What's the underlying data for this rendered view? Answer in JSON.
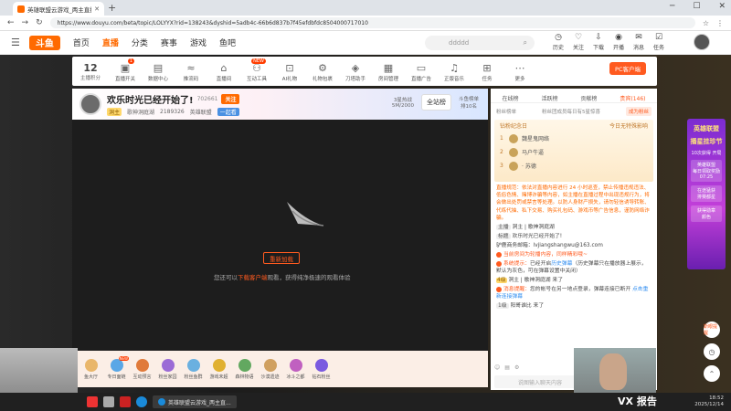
{
  "browser": {
    "tab_title": "英雄联盟云游戏_两主直播_两主 | 斗鱼",
    "url": "https://www.douyu.com/beta/topic/LOLYYX?rid=138243&dyshid=5adb4c-66b6d837b7f45efdbfdc8504000717010"
  },
  "site": {
    "logo": "斗鱼",
    "nav": [
      "首页",
      "直播",
      "分类",
      "赛事",
      "游戏",
      "鱼吧"
    ],
    "search_placeholder": "ddddd",
    "header_icons": [
      {
        "icon": "history-icon",
        "label": "历史"
      },
      {
        "icon": "follow-icon",
        "label": "关注"
      },
      {
        "icon": "download-icon",
        "label": "下载"
      },
      {
        "icon": "broadcast-icon",
        "label": "开播"
      },
      {
        "icon": "message-icon",
        "label": "消息"
      },
      {
        "icon": "task-icon",
        "label": "任务"
      }
    ]
  },
  "toolbar": {
    "level_number": "12",
    "level_label": "主播积分",
    "tools": [
      {
        "label": "直播开关",
        "icon": "switch-icon",
        "badge": "1"
      },
      {
        "label": "数据中心",
        "icon": "data-icon"
      },
      {
        "label": "推流码",
        "icon": "wave-icon"
      },
      {
        "label": "直播间",
        "icon": "room-icon"
      },
      {
        "label": "互动工具",
        "icon": "people-icon",
        "badge": "NEW"
      },
      {
        "label": "AI礼物",
        "icon": "ai-icon"
      },
      {
        "label": "礼物包裹",
        "icon": "gift-box-icon"
      },
      {
        "label": "刀塔助手",
        "icon": "helper-icon"
      },
      {
        "label": "房间管理",
        "icon": "manage-icon"
      },
      {
        "label": "直播广告",
        "icon": "ad-icon"
      },
      {
        "label": "正版音乐",
        "icon": "music-icon"
      },
      {
        "label": "任务",
        "icon": "gift-icon"
      },
      {
        "label": "更多",
        "icon": "more-icon"
      }
    ],
    "pc_button": "PC客户端"
  },
  "room": {
    "title": "欢乐时光已经开始了!",
    "room_id": "702661",
    "follow_label": "关注",
    "host_label": "洞主",
    "category": "歌神洞庭湖",
    "fans_count": "2189326",
    "game": "英雄联盟",
    "link_label": "一起看",
    "hot_label": "3星热战",
    "hot_value": "5M/2000",
    "all_station_label": "全站榜",
    "rank_label": "斗鱼榜单",
    "rank_value": "排10名"
  },
  "video": {
    "reload_label": "重新加载",
    "tip_before": "您还可以",
    "tip_highlight": "下载客户端",
    "tip_after": "观看，获得纯净极速的观看体验"
  },
  "gifts": [
    {
      "label": "鱼大厅"
    },
    {
      "label": "专日面链",
      "badge": "NEW"
    },
    {
      "label": "互动预言"
    },
    {
      "label": "粉丝家园"
    },
    {
      "label": "粉丝鱼群"
    },
    {
      "label": "游戏未超"
    },
    {
      "label": "森林物语"
    },
    {
      "label": "沙漠遗迹"
    },
    {
      "label": "冰斗之都"
    },
    {
      "label": "钻石粉丝"
    }
  ],
  "chat": {
    "rank_tabs": [
      "在线榜",
      "活跃榜",
      "贡献榜",
      "贵宾(146)"
    ],
    "fans_text": "粉丝榜单",
    "fans_sub": "粉丝团成员每日有5星惊喜",
    "fans_btn": "成为粉丝",
    "vip_title": "钻粉纪念日",
    "vip_right": "今日无特殊影响",
    "vip_list": [
      {
        "rank": "1",
        "name": "魏星鬼网络"
      },
      {
        "rank": "2",
        "name": "马户牛逼"
      },
      {
        "rank": "3",
        "name": "· 苏德"
      }
    ],
    "notice": "直播规范：依法对直播内容进行 24 小时巡查，禁止传播违规违法、低俗色情、赌博诈骗等内容，如主播在直播过程中出现违规行为，将会做出处罚或禁言等处理。以防人身财产损失，请勿轻信诱导转账、代练代抽、私下交易、购买礼包码、游戏币等广告信息，谨防网络诈骗。",
    "messages": [
      {
        "key": "主播",
        "text": "洞主 | 歌神洞庭湖"
      },
      {
        "key": "标题",
        "text": "欢乐时光已经开始了!"
      },
      {
        "key": "",
        "text": "驴鹿商务邮箱：lvjiangshangwu@163.com"
      },
      {
        "key": "",
        "sys": "当前房间为轮播内容，同样精彩哦~"
      },
      {
        "key": "",
        "sys": "系统提示：",
        "text": "已经开启",
        "blue": "历史弹幕",
        "tail": "（历史弹幕只在播放器上展示，默认为灰色，可在弹幕设置中关闭）"
      },
      {
        "key": "",
        "lvl": "4级",
        "text": "洞主 | 歌神洞庭湖 来了"
      },
      {
        "key": "",
        "sys": "消息提醒：",
        "text": "您的帐号在另一地点登录，弹幕连接已断开",
        "blue": "点击重新连接弹幕"
      },
      {
        "key": "1级",
        "text": "阳哥谁比 来了"
      }
    ],
    "input_placeholder": "说图输入聊天内容"
  },
  "side_ad": {
    "line1": "英雄联盟",
    "line2": "播星挂珍节",
    "line3": "10次获得 开局",
    "line4": "英雄联盟",
    "line5": "每日领取奖励",
    "line6": "07:25",
    "line7": "在途猛获",
    "line8": "排赛都星",
    "line9": "获得勋章",
    "line10": "颜色"
  },
  "side_buttons": [
    "斯眼提醒",
    "返回顶部",
    "回到顶部"
  ],
  "watermark": "VX 报告",
  "taskbar": {
    "app_label": "英雄联盟云游戏_两主直...",
    "time": "18:52",
    "date": "2025/12/14"
  }
}
